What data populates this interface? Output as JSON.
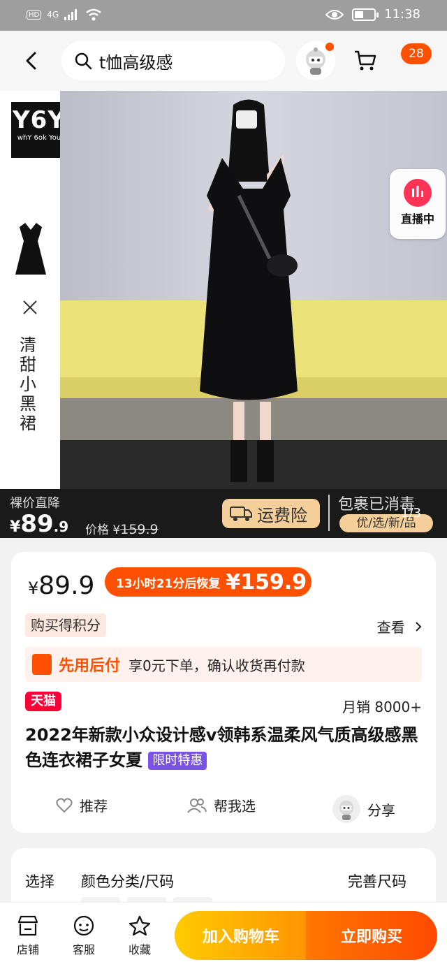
{
  "status_bar": {
    "hd": "HD",
    "net": "4G",
    "time": "11:38",
    "battery_level": 0.45
  },
  "header": {
    "search_query": "t恤高级感",
    "cart_count": "28"
  },
  "gallery": {
    "brand_big": "Y6Y",
    "brand_small": "whY 6ok You",
    "side_label": "清甜小黑裙",
    "live_label": "直播中",
    "promo_label": "裸价直降",
    "promo_yen": "¥",
    "promo_price_int": "89",
    "promo_price_dec": ".9",
    "orig_prefix": "价格 ¥",
    "orig_price": "159.9",
    "freight": "运费险",
    "parcel": "包裹已消毒",
    "youxuan": "优/选/新/品",
    "page_indicator": "1/3"
  },
  "product": {
    "yen": "¥",
    "price": "89.9",
    "restore_text": "13小时21分后恢复",
    "restore_price": "¥159.9",
    "points_label": "购买得积分",
    "view_label": "查看",
    "pay_later_title": "先用后付",
    "pay_later_desc": "享0元下单，确认收货再付款",
    "tmall": "天猫",
    "monthly_sales": "月销 8000+",
    "title": "2022年新款小众设计感v领韩系温柔风气质高级感黑色连衣裙子女夏",
    "limited_badge": "限时特惠",
    "actions": {
      "recommend": "推荐",
      "help_choose": "帮我选",
      "share": "分享"
    }
  },
  "options": {
    "select_label": "选择",
    "spec_label": "颜色分类/尺码",
    "size_label": "完善尺码"
  },
  "bottom_bar": {
    "shop": "店铺",
    "service": "客服",
    "favorite": "收藏",
    "add_cart": "加入购物车",
    "buy_now": "立即购买"
  },
  "colors": {
    "accent": "#ff5000",
    "tmall": "#ff0036",
    "promo_badge": "#7a52e6",
    "cart_btn": "#ffb000",
    "buy_btn": "#ff5a00"
  }
}
